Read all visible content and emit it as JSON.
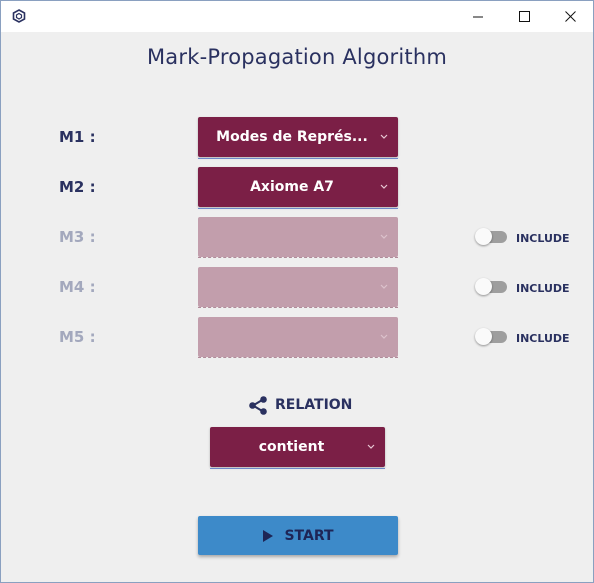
{
  "window": {
    "controls": {
      "minimize": "–",
      "maximize": "☐",
      "close": "✕"
    }
  },
  "app": {
    "title": "Mark-Propagation Algorithm"
  },
  "marks": [
    {
      "label": "M1 :",
      "value": "Modes de Représ...",
      "enabled": true
    },
    {
      "label": "M2 :",
      "value": "Axiome A7",
      "enabled": true
    },
    {
      "label": "M3 :",
      "value": "",
      "enabled": false,
      "toggle_label": "INCLUDE",
      "included": false
    },
    {
      "label": "M4 :",
      "value": "",
      "enabled": false,
      "toggle_label": "INCLUDE",
      "included": false
    },
    {
      "label": "M5 :",
      "value": "",
      "enabled": false,
      "toggle_label": "INCLUDE",
      "included": false
    }
  ],
  "relation": {
    "icon": "share-icon",
    "label": "RELATION",
    "value": "contient"
  },
  "start": {
    "icon": "play-icon",
    "label": "START"
  },
  "colors": {
    "accent": "#7b1f46",
    "accent_disabled": "#c29eac",
    "start_button": "#3d8ac9",
    "text": "#2a3160"
  }
}
